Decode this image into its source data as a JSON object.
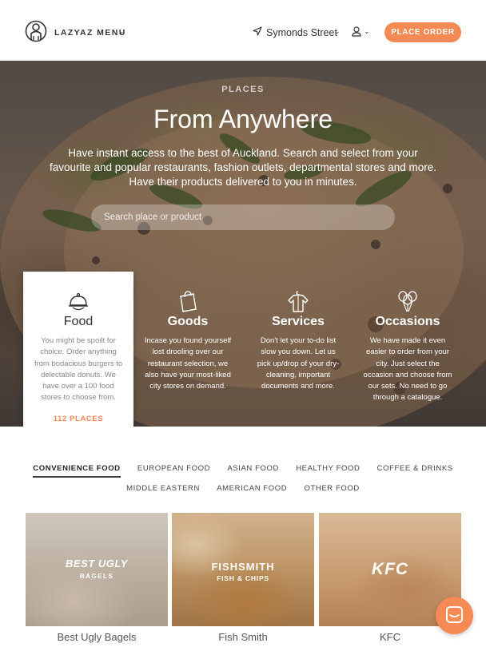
{
  "header": {
    "brand": "LAZYAZ MENU",
    "location": "Symonds Street",
    "order_button": "PLACE ORDER"
  },
  "hero": {
    "eyebrow": "PLACES",
    "title": "From Anywhere",
    "description": "Have instant access to the best of Auckland. Search and select from your favourite and popular restaurants, fashion outlets, departmental stores and more. Have their products delivered to you in minutes.",
    "search_placeholder": "Search place or product"
  },
  "categories": [
    {
      "name": "Food",
      "icon": "cloche-icon",
      "active": true,
      "description": "You might be spoilt for choice. Order anything from bodacious burgers to delectable donuts. We have over a 100 food stores to choose from.",
      "count": "112 PLACES"
    },
    {
      "name": "Goods",
      "icon": "shopping-bag-icon",
      "active": false,
      "description": "Incase you found yourself lost drooling over our restaurant selection, we also have your most-liked city stores on demand."
    },
    {
      "name": "Services",
      "icon": "shirt-hanger-icon",
      "active": false,
      "description": "Don't let your to-do list slow you down. Let us pick up/drop of your dry-cleaning, important documents and more."
    },
    {
      "name": "Occasions",
      "icon": "balloons-icon",
      "active": false,
      "description": "We have made it even easier to order from your city. Just select the occasion and choose from our sets. No need to go through a catalogue."
    }
  ],
  "tabs_row1": [
    "CONVENIENCE FOOD",
    "EUROPEAN FOOD",
    "ASIAN FOOD",
    "HEALTHY FOOD",
    "COFFEE & DRINKS"
  ],
  "tabs_row2": [
    "MIDDLE EASTERN",
    "AMERICAN FOOD",
    "OTHER FOOD"
  ],
  "active_tab": "CONVENIENCE FOOD",
  "restaurants": [
    {
      "name": "Best Ugly Bagels",
      "logo_line1": "BEST UGLY",
      "logo_line2": "BAGELS"
    },
    {
      "name": "Fish Smith",
      "logo_line1": "FISHSMITH",
      "logo_line2": "FISH & CHIPS"
    },
    {
      "name": "KFC",
      "logo_line1": "KFC",
      "logo_line2": ""
    }
  ],
  "colors": {
    "accent": "#f58a54"
  }
}
